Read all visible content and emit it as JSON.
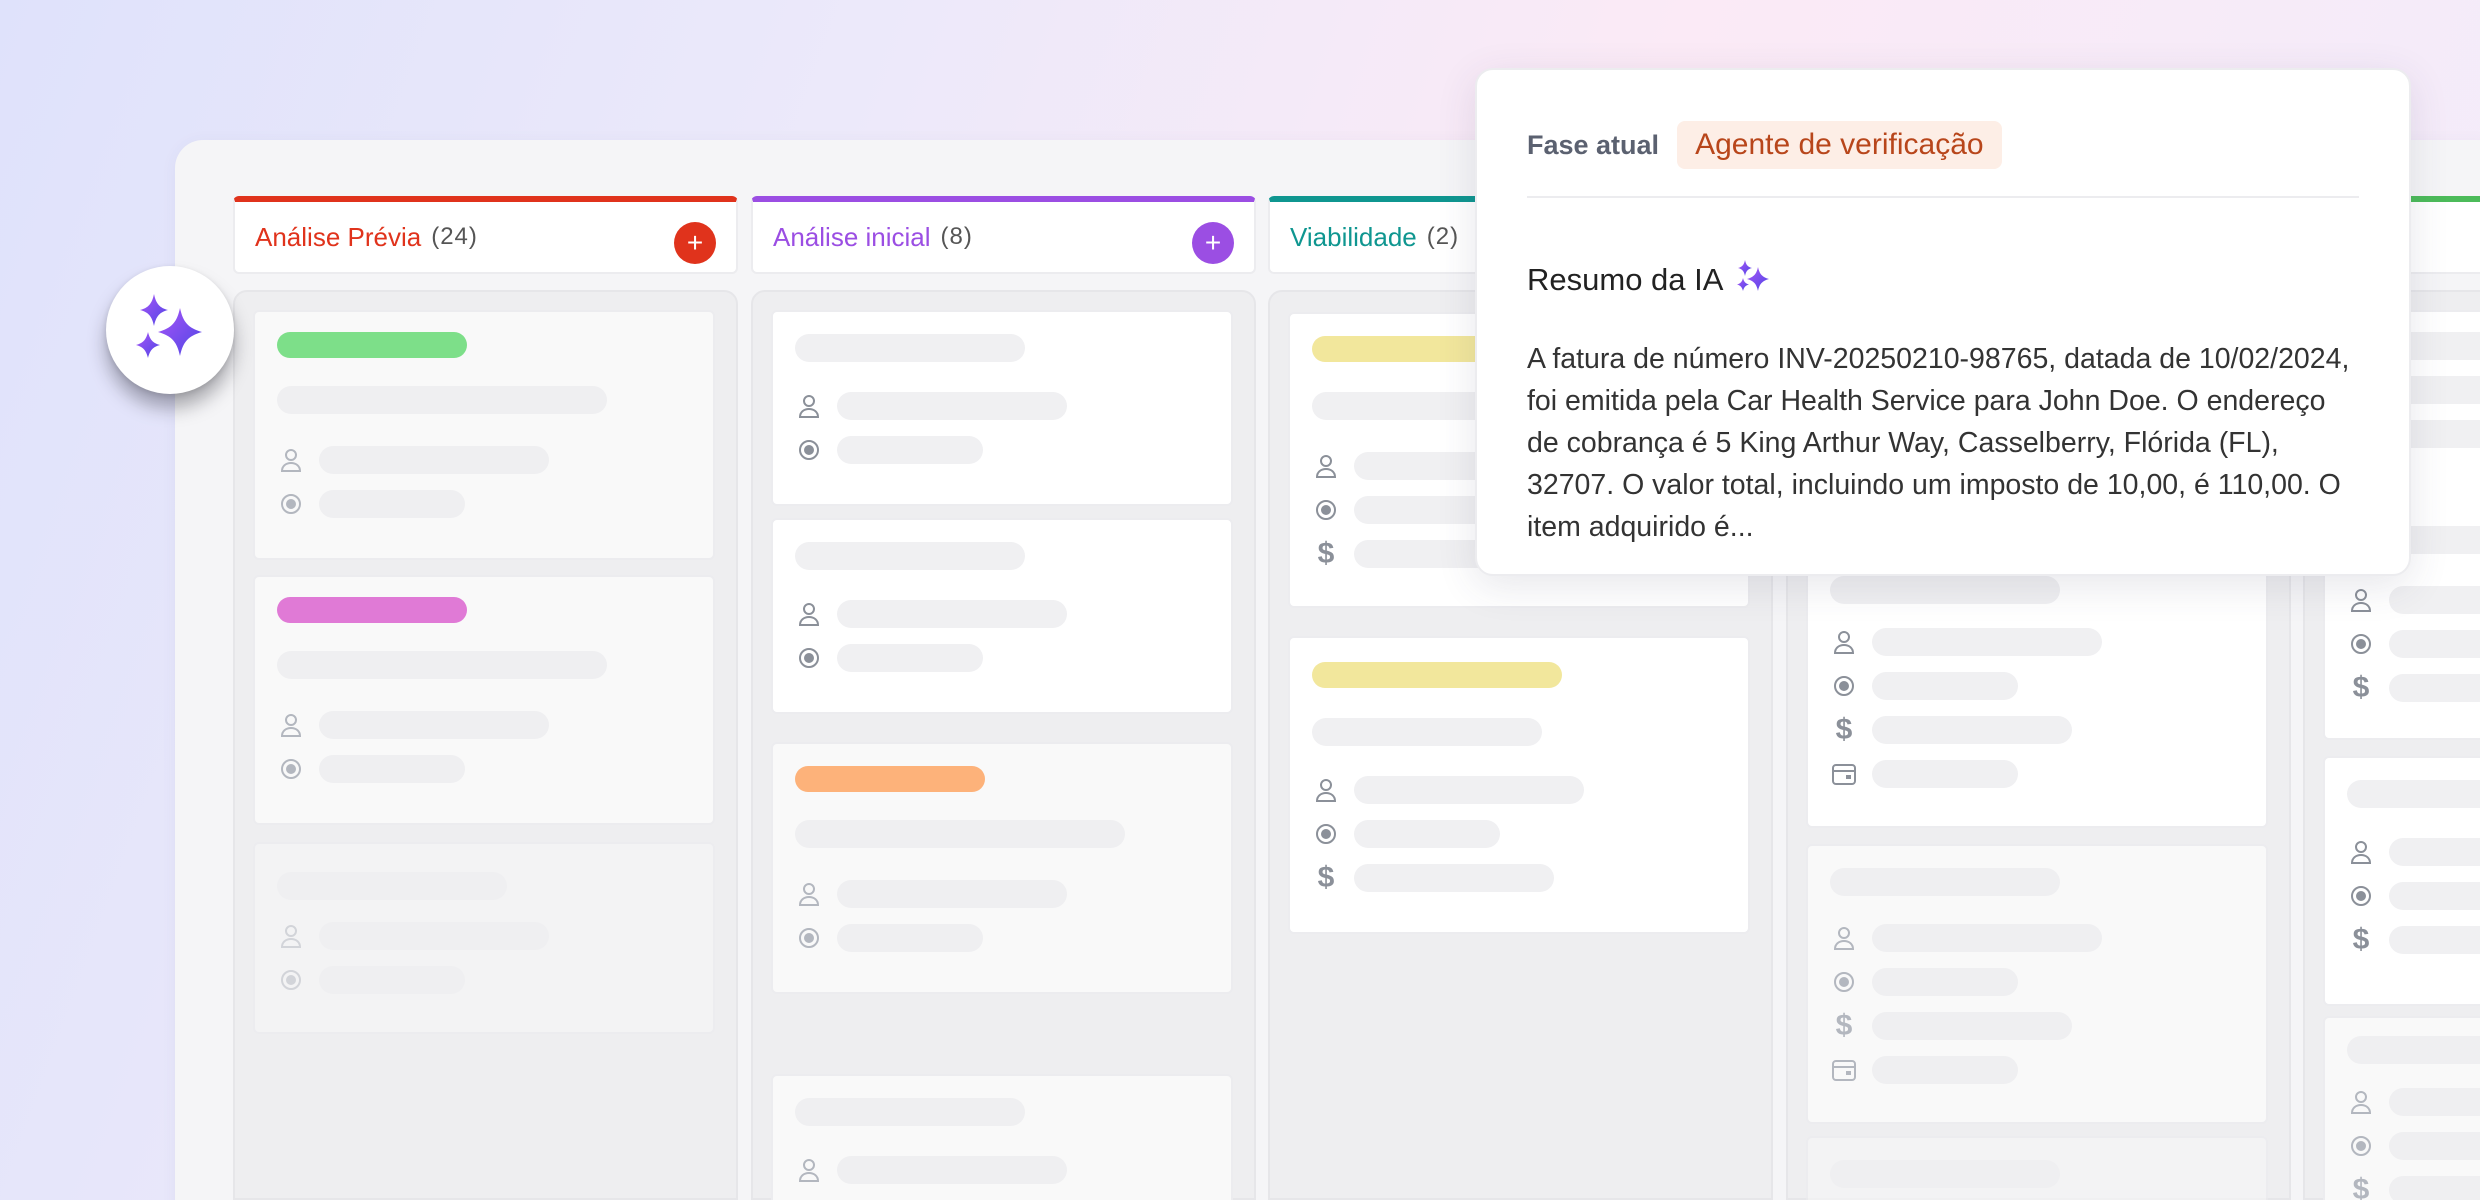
{
  "columns": [
    {
      "title": "Análise Prévia",
      "count": "(24)",
      "color": "#e0331c",
      "has_add": true
    },
    {
      "title": "Análise inicial",
      "count": "(8)",
      "color": "#9b4ee3",
      "has_add": true
    },
    {
      "title": "Viabilidade",
      "count": "(2)",
      "color": "#0f9690",
      "has_add": false
    }
  ],
  "tag_colors": {
    "green": "#7ddf89",
    "pink": "#e07ad6",
    "orange": "#fdb27a",
    "yellow": "#f2e79c"
  },
  "add_label": "+",
  "currency_symbol": "$",
  "popover": {
    "phase_label": "Fase atual",
    "phase_value": "Agente de verificação",
    "summary_title": "Resumo da IA",
    "summary_text": "A fatura de número INV-20250210-98765, datada de 10/02/2024, foi emitida pela Car Health Service para John Doe. O endereço de cobrança é 5 King Arthur Way, Casselberry, Flórida (FL), 32707. O valor total, incluindo um imposto de 10,00, é 110,00. O item adquirido é..."
  },
  "icons": {
    "ai_badge": "sparkles-icon",
    "assignee": "user-icon",
    "status": "radio-dot-icon",
    "amount": "dollar-icon",
    "date": "calendar-icon"
  }
}
